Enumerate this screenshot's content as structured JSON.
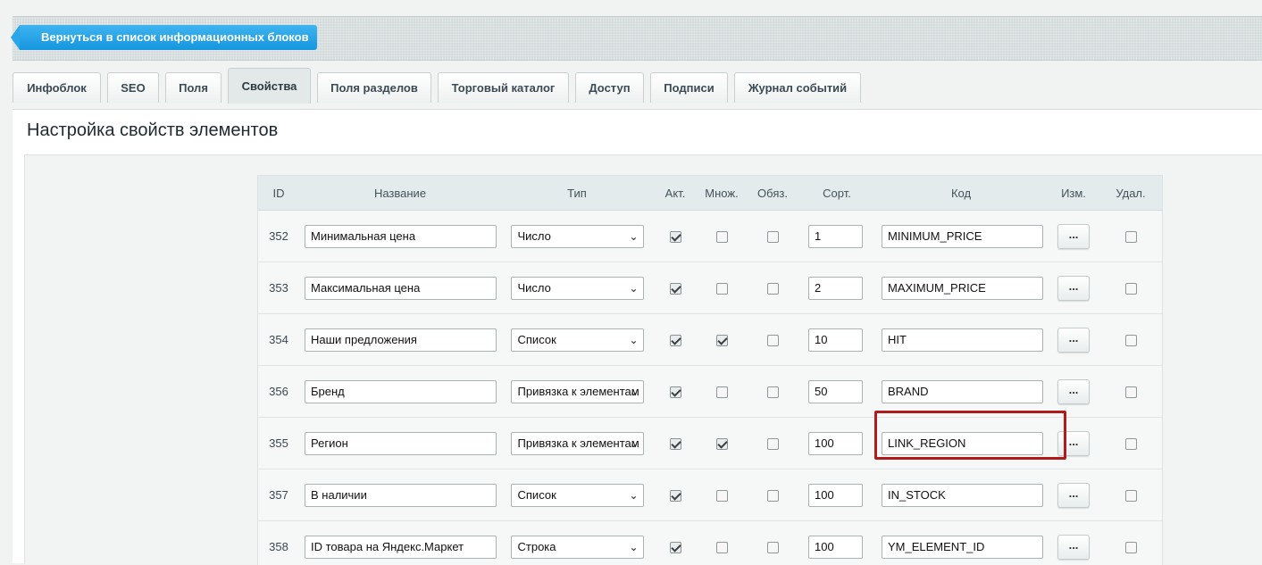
{
  "back_button": {
    "label": "Вернуться в список информационных блоков"
  },
  "tabs": [
    {
      "label": "Инфоблок",
      "active": false
    },
    {
      "label": "SEO",
      "active": false
    },
    {
      "label": "Поля",
      "active": false
    },
    {
      "label": "Свойства",
      "active": true
    },
    {
      "label": "Поля разделов",
      "active": false
    },
    {
      "label": "Торговый каталог",
      "active": false
    },
    {
      "label": "Доступ",
      "active": false
    },
    {
      "label": "Подписи",
      "active": false
    },
    {
      "label": "Журнал событий",
      "active": false
    }
  ],
  "page_title": "Настройка свойств элементов",
  "table": {
    "headers": {
      "id": "ID",
      "name": "Название",
      "type": "Тип",
      "active": "Акт.",
      "multiple": "Множ.",
      "required": "Обяз.",
      "sort": "Сорт.",
      "code": "Код",
      "edit": "Изм.",
      "delete": "Удал."
    },
    "edit_button_label": "...",
    "rows": [
      {
        "id": "352",
        "name": "Минимальная цена",
        "type": "Число",
        "active": true,
        "multiple": false,
        "required": false,
        "sort": "1",
        "code": "MINIMUM_PRICE",
        "delete": false
      },
      {
        "id": "353",
        "name": "Максимальная цена",
        "type": "Число",
        "active": true,
        "multiple": false,
        "required": false,
        "sort": "2",
        "code": "MAXIMUM_PRICE",
        "delete": false
      },
      {
        "id": "354",
        "name": "Наши предложения",
        "type": "Список",
        "active": true,
        "multiple": true,
        "required": false,
        "sort": "10",
        "code": "HIT",
        "delete": false
      },
      {
        "id": "356",
        "name": "Бренд",
        "type": "Привязка к элементам",
        "active": true,
        "multiple": false,
        "required": false,
        "sort": "50",
        "code": "BRAND",
        "delete": false,
        "highlighted": true
      },
      {
        "id": "355",
        "name": "Регион",
        "type": "Привязка к элементам",
        "active": true,
        "multiple": true,
        "required": false,
        "sort": "100",
        "code": "LINK_REGION",
        "delete": false
      },
      {
        "id": "357",
        "name": "В наличии",
        "type": "Список",
        "active": true,
        "multiple": false,
        "required": false,
        "sort": "100",
        "code": "IN_STOCK",
        "delete": false
      },
      {
        "id": "358",
        "name": "ID товара на Яндекс.Маркет",
        "type": "Строка",
        "active": true,
        "multiple": false,
        "required": false,
        "sort": "100",
        "code": "YM_ELEMENT_ID",
        "delete": false
      }
    ]
  },
  "colors": {
    "back_button": "#1a9be2",
    "highlight_border": "#b01c1c"
  }
}
